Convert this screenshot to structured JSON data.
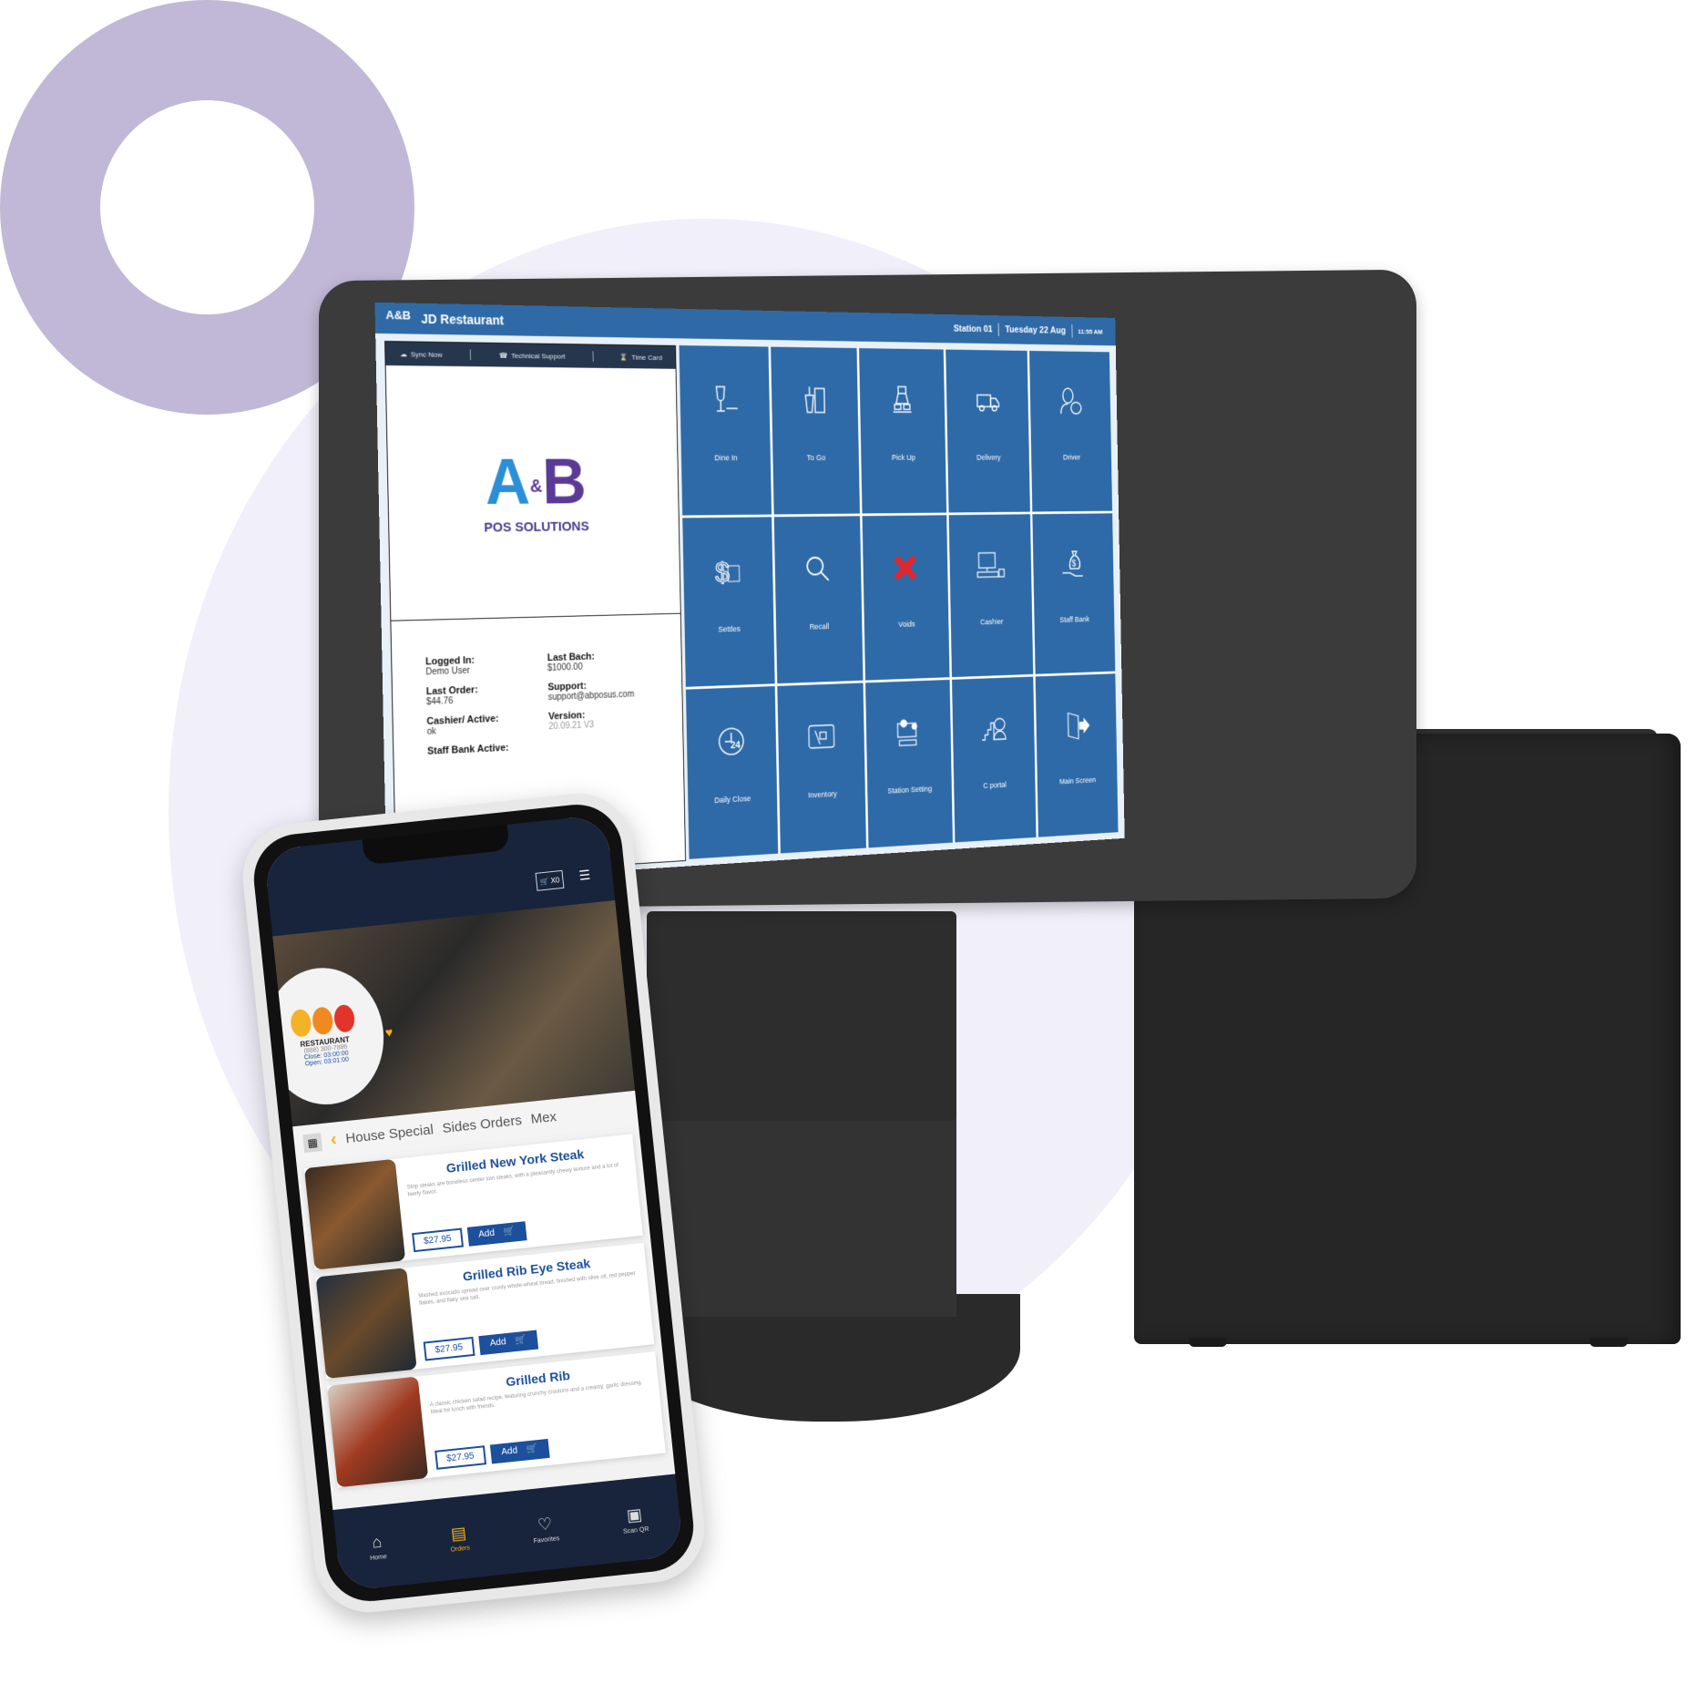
{
  "pos": {
    "app_title": "JD Restaurant",
    "station": "Station 01",
    "date": "Tuesday 22 Aug",
    "time": "11:55 AM",
    "toolbar": [
      {
        "label": "Sync Now",
        "icon": "cloud-sync-icon"
      },
      {
        "label": "Technical Support",
        "icon": "headset-icon"
      },
      {
        "label": "Time Card",
        "icon": "time-card-icon"
      }
    ],
    "brand": {
      "mark_a": "A",
      "mark_amp": "&",
      "mark_b": "B",
      "tagline": "POS SOLUTIONS"
    },
    "info": {
      "logged_in_label": "Logged In:",
      "logged_in_value": "Demo User",
      "last_batch_label": "Last Bach:",
      "last_batch_value": "$1000.00",
      "last_order_label": "Last Order:",
      "last_order_value": "$44.76",
      "support_label": "Support:",
      "support_value": "support@abposus.com",
      "cashier_active_label": "Cashier/ Active:",
      "cashier_active_value": "ok",
      "version_label": "Version:",
      "version_value": "20.09.21 V3",
      "staff_bank_label": "Staff Bank Active:"
    },
    "tiles": [
      {
        "label": "Dine In",
        "icon": "wine-glass-icon"
      },
      {
        "label": "To Go",
        "icon": "takeaway-bag-icon"
      },
      {
        "label": "Pick Up",
        "icon": "pickup-icon"
      },
      {
        "label": "Delivery",
        "icon": "delivery-truck-icon"
      },
      {
        "label": "Driver",
        "icon": "driver-icon"
      },
      {
        "label": "Settles",
        "icon": "dollar-card-icon"
      },
      {
        "label": "Recall",
        "icon": "magnifier-icon"
      },
      {
        "label": "Voids",
        "icon": "red-x-icon"
      },
      {
        "label": "Cashier",
        "icon": "cash-register-icon"
      },
      {
        "label": "Staff Bank",
        "icon": "money-bag-icon"
      },
      {
        "label": "Daily Close",
        "icon": "clock-24-icon"
      },
      {
        "label": "Inventory",
        "icon": "inventory-icon"
      },
      {
        "label": "Station Setting",
        "icon": "settings-monitor-icon"
      },
      {
        "label": "C portal",
        "icon": "portal-chart-icon"
      },
      {
        "label": "Main Screen",
        "icon": "exit-door-icon"
      }
    ],
    "colors": {
      "header": "#2f6aa7",
      "tile": "#2e6aa8",
      "void_red": "#e5252a",
      "toolbar": "#26364d"
    }
  },
  "phone": {
    "cart_count": "X0",
    "restaurant": {
      "name": "RESTAURANT",
      "phone": "(888) 300-7886",
      "close": "Close: 03:00:00",
      "open": "Open: 03:01:00"
    },
    "categories": [
      "House Special",
      "Sides Orders",
      "Mex"
    ],
    "items": [
      {
        "name": "Grilled New York Steak",
        "desc": "Strip steaks are boneless center loin steaks, with a pleasantly chewy texture and a lot of beefy flavor.",
        "price": "$27.95",
        "add": "Add"
      },
      {
        "name": "Grilled Rib Eye Steak",
        "desc": "Mashed avocado spread over crusty whole-wheat bread, finished with olive oil, red pepper flakes, and flaky sea salt.",
        "price": "$27.95",
        "add": "Add"
      },
      {
        "name": "Grilled Rib",
        "desc": "A classic chicken salad recipe, featuring crunchy croutons and a creamy, garlic dressing. Ideal for lunch with friends.",
        "price": "$27.95",
        "add": "Add"
      }
    ],
    "nav": [
      {
        "label": "Home",
        "icon": "home-icon"
      },
      {
        "label": "Orders",
        "icon": "orders-icon",
        "active": true
      },
      {
        "label": "Favorites",
        "icon": "heart-icon"
      },
      {
        "label": "Scan QR",
        "icon": "qr-code-icon"
      }
    ],
    "colors": {
      "brand_blue": "#1c4f9c",
      "accent_yellow": "#f2b31b",
      "nav_bg": "#18233c"
    }
  },
  "decor": {
    "ring_color": "#c0b8d6",
    "circle_color": "#f1eff9"
  }
}
